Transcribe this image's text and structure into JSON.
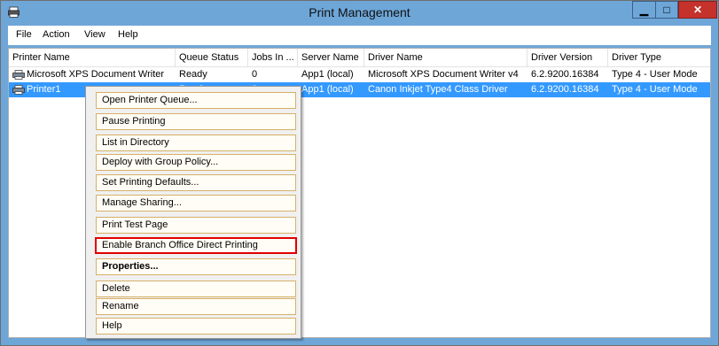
{
  "window": {
    "title": "Print Management"
  },
  "menubar": {
    "items": [
      "File",
      "Action",
      "View",
      "Help"
    ]
  },
  "table": {
    "columns": [
      "Printer Name",
      "Queue Status",
      "Jobs In ...",
      "Server Name",
      "Driver Name",
      "Driver Version",
      "Driver Type"
    ],
    "rows": [
      [
        "Microsoft XPS Document Writer",
        "Ready",
        "0",
        "App1 (local)",
        "Microsoft XPS Document Writer v4",
        "6.2.9200.16384",
        "Type 4 - User Mode"
      ],
      [
        "Printer1",
        "Ready",
        "0",
        "App1 (local)",
        "Canon Inkjet Type4 Class Driver",
        "6.2.9200.16384",
        "Type 4 - User Mode"
      ]
    ],
    "selected_row": 1
  },
  "context_menu": {
    "items": [
      "Open Printer Queue...",
      "Pause Printing",
      "List in Directory",
      "Deploy with Group Policy...",
      "Set Printing Defaults...",
      "Manage Sharing...",
      "Print Test Page",
      "Enable Branch Office Direct Printing",
      "Properties...",
      "Delete",
      "Rename",
      "Help"
    ],
    "highlighted_item": "Enable Branch Office Direct Printing",
    "bold_item": "Properties..."
  },
  "colors": {
    "titlebar": "#6ea6d8",
    "selection": "#3399ff",
    "close": "#c4322b",
    "highlight_border": "#e00000"
  },
  "icons": {
    "app": "printer-management-icon",
    "row": "printer-icon"
  }
}
